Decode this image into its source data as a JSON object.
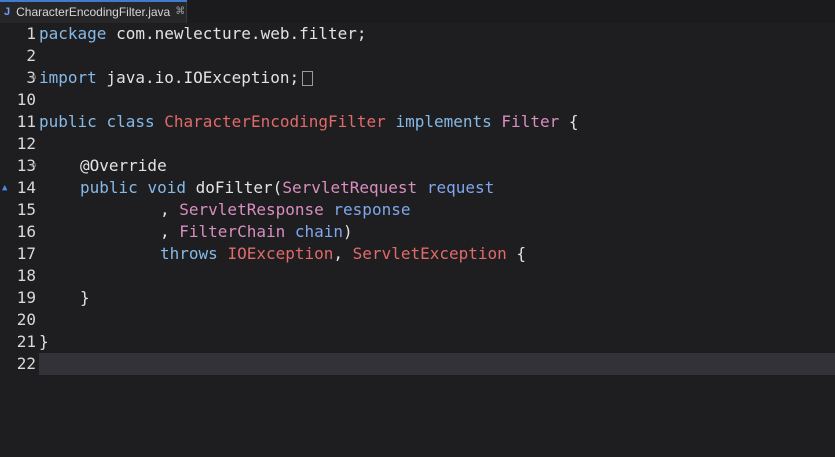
{
  "tab": {
    "icon": "java-file-icon",
    "title": "CharacterEncodingFilter.java",
    "close": "⌘"
  },
  "gutter": [
    "1",
    "2",
    "3",
    "10",
    "11",
    "12",
    "13",
    "14",
    "15",
    "16",
    "17",
    "18",
    "19",
    "20",
    "21",
    "22"
  ],
  "code": {
    "l1": {
      "kw": "package",
      "rest": " com.newlecture.web.filter;"
    },
    "l3": {
      "kw": "import",
      "rest": " java.io.IOException;"
    },
    "l11": {
      "kw1": "public",
      "kw2": "class",
      "cls": "CharacterEncodingFilter",
      "kw3": "implements",
      "iface": "Filter",
      "brace": " {"
    },
    "l13": {
      "ann": "@Override"
    },
    "l14": {
      "kw1": "public",
      "kw2": "void",
      "method": "doFilter(",
      "type": "ServletRequest",
      "param": "request"
    },
    "l15": {
      "comma": ", ",
      "type": "ServletResponse",
      "param": "response"
    },
    "l16": {
      "comma": ", ",
      "type": "FilterChain",
      "param": "chain",
      "close": ")"
    },
    "l17": {
      "kw": "throws",
      "exc1": "IOException",
      "sep": ", ",
      "exc2": "ServletException",
      "brace": " {"
    },
    "l19": {
      "brace": "}"
    },
    "l21": {
      "brace": "}"
    }
  },
  "colors": {
    "keyword": "#86b9e6",
    "type": "#d98ec0",
    "exception": "#e16a6a",
    "parameter": "#7fa6ee",
    "background": "#1e1e20",
    "current_line": "#323238"
  }
}
